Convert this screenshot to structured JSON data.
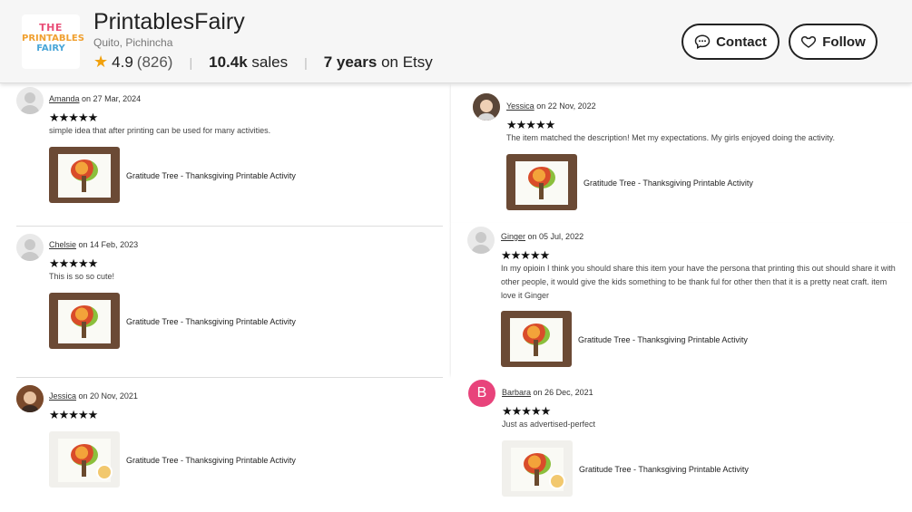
{
  "shop": {
    "logo_text": [
      "THE",
      "PRINTABLES",
      "FAIRY"
    ],
    "name": "PrintablesFairy",
    "location": "Quito, Pichincha",
    "rating": "4.9",
    "review_count": "(826)",
    "sales_value": "10.4k",
    "sales_label": "sales",
    "years_value": "7 years",
    "years_label": "on Etsy",
    "contact_label": "Contact",
    "follow_label": "Follow"
  },
  "reviews": [
    {
      "name": "Amanda",
      "date": "on 27 Mar, 2024",
      "stars": "★★★★★",
      "text": "simple idea that after printing can be used for many activities.",
      "product": "Gratitude Tree - Thanksgiving Printable Activity",
      "avatar": "generic"
    },
    {
      "name": "Chelsie",
      "date": "on 14 Feb, 2023",
      "stars": "★★★★★",
      "text": "This is so so cute!",
      "product": "Gratitude Tree - Thanksgiving Printable Activity",
      "avatar": "generic"
    },
    {
      "name": "Jessica",
      "date": "on 20 Nov, 2021",
      "stars": "★★★★★",
      "text": "",
      "product": "Gratitude Tree - Thanksgiving Printable Activity",
      "avatar": "photo"
    },
    {
      "name": "Yessica",
      "date": "on 22 Nov, 2022",
      "stars": "★★★★★",
      "text": "The item matched the description! Met my expectations. My girls enjoyed doing the activity.",
      "product": "Gratitude Tree - Thanksgiving Printable Activity",
      "avatar": "photo"
    },
    {
      "name": "Ginger",
      "date": "on 05 Jul, 2022",
      "stars": "★★★★★",
      "text": "In my opioin I think you should share this item your have the persona that printing this out should share it with other people, it would give the kids something to be thank ful for other then that it is a pretty neat craft. item love it Ginger",
      "product": "Gratitude Tree - Thanksgiving Printable Activity",
      "avatar": "generic"
    },
    {
      "name": "Barbara",
      "date": "on 26 Dec, 2021",
      "stars": "★★★★★",
      "text": "Just as advertised-perfect",
      "product": "Gratitude Tree - Thanksgiving Printable Activity",
      "avatar": "letter",
      "avatar_letter": "B"
    }
  ],
  "colors": {
    "star": "#f1a10d",
    "avatar_letter_bg": "#e8437b"
  }
}
